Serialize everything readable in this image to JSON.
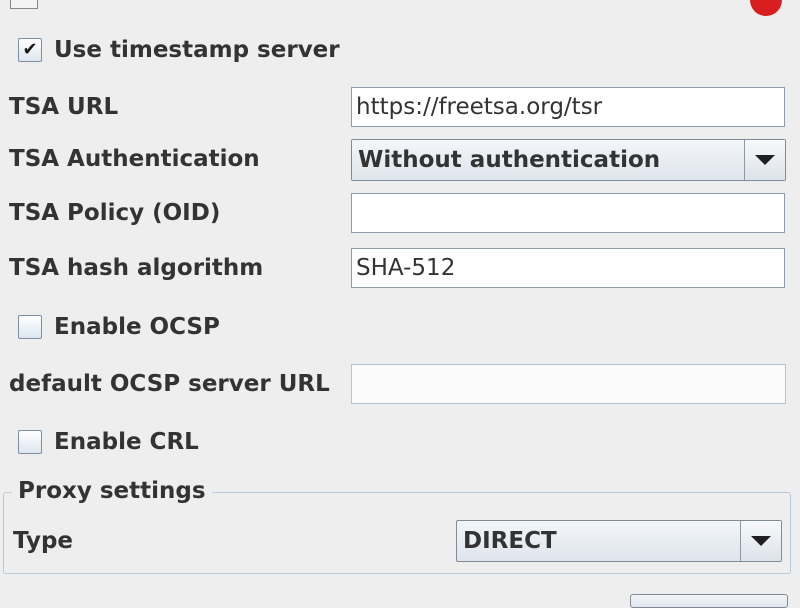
{
  "window": {
    "app_icon": "app-icon",
    "close_icon": "close-icon"
  },
  "timestamp": {
    "use_server_label": "Use timestamp server",
    "use_server_checked": true,
    "check_mark": "✔",
    "tsa_url_label": "TSA URL",
    "tsa_url_value": "https://freetsa.org/tsr",
    "tsa_auth_label": "TSA Authentication",
    "tsa_auth_value": "Without authentication",
    "tsa_policy_label": "TSA Policy (OID)",
    "tsa_policy_value": "",
    "tsa_hash_label": "TSA hash algorithm",
    "tsa_hash_value": "SHA-512"
  },
  "ocsp": {
    "enable_label": "Enable OCSP",
    "enable_checked": false,
    "server_url_label": "default OCSP server URL",
    "server_url_value": ""
  },
  "crl": {
    "enable_label": "Enable CRL",
    "enable_checked": false
  },
  "proxy": {
    "group_title": "Proxy settings",
    "type_label": "Type",
    "type_value": "DIRECT"
  },
  "colors": {
    "background": "#eeeeee",
    "close_button": "#d81e1e"
  }
}
